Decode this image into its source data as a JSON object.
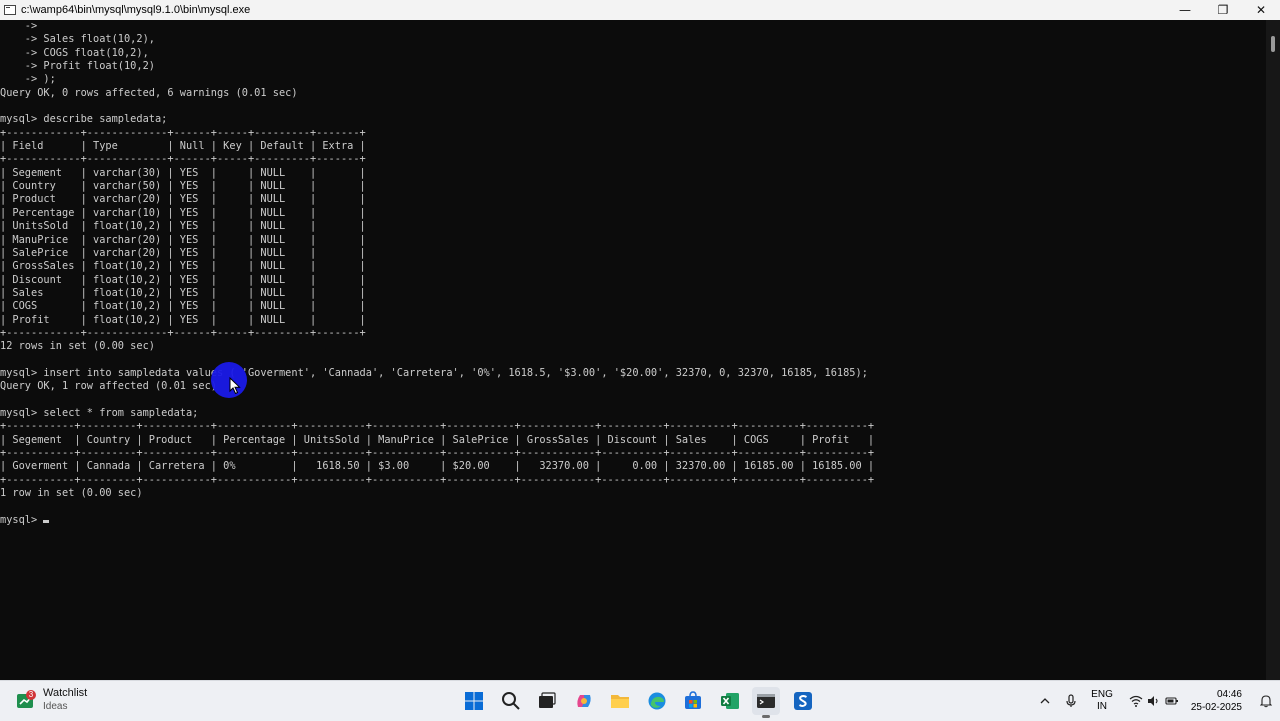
{
  "window": {
    "title": "c:\\wamp64\\bin\\mysql\\mysql9.1.0\\bin\\mysql.exe",
    "minimize_glyph": "—",
    "maximize_glyph": "❐",
    "close_glyph": "✕"
  },
  "terminal_lines": [
    "    ->",
    "    -> Sales float(10,2),",
    "    -> COGS float(10,2),",
    "    -> Profit float(10,2)",
    "    -> );",
    "Query OK, 0 rows affected, 6 warnings (0.01 sec)",
    "",
    "mysql> describe sampledata;",
    "+------------+-------------+------+-----+---------+-------+",
    "| Field      | Type        | Null | Key | Default | Extra |",
    "+------------+-------------+------+-----+---------+-------+",
    "| Segement   | varchar(30) | YES  |     | NULL    |       |",
    "| Country    | varchar(50) | YES  |     | NULL    |       |",
    "| Product    | varchar(20) | YES  |     | NULL    |       |",
    "| Percentage | varchar(10) | YES  |     | NULL    |       |",
    "| UnitsSold  | float(10,2) | YES  |     | NULL    |       |",
    "| ManuPrice  | varchar(20) | YES  |     | NULL    |       |",
    "| SalePrice  | varchar(20) | YES  |     | NULL    |       |",
    "| GrossSales | float(10,2) | YES  |     | NULL    |       |",
    "| Discount   | float(10,2) | YES  |     | NULL    |       |",
    "| Sales      | float(10,2) | YES  |     | NULL    |       |",
    "| COGS       | float(10,2) | YES  |     | NULL    |       |",
    "| Profit     | float(10,2) | YES  |     | NULL    |       |",
    "+------------+-------------+------+-----+---------+-------+",
    "12 rows in set (0.00 sec)",
    "",
    "mysql> insert into sampledata values ( 'Goverment', 'Cannada', 'Carretera', '0%', 1618.5, '$3.00', '$20.00', 32370, 0, 32370, 16185, 16185);",
    "Query OK, 1 row affected (0.01 sec)",
    "",
    "mysql> select * from sampledata;",
    "+-----------+---------+-----------+------------+-----------+-----------+-----------+------------+----------+----------+----------+----------+",
    "| Segement  | Country | Product   | Percentage | UnitsSold | ManuPrice | SalePrice | GrossSales | Discount | Sales    | COGS     | Profit   |",
    "+-----------+---------+-----------+------------+-----------+-----------+-----------+------------+----------+----------+----------+----------+",
    "| Goverment | Cannada | Carretera | 0%         |   1618.50 | $3.00     | $20.00    |   32370.00 |     0.00 | 32370.00 | 16185.00 | 16185.00 |",
    "+-----------+---------+-----------+------------+-----------+-----------+-----------+------------+----------+----------+----------+----------+",
    "1 row in set (0.00 sec)",
    ""
  ],
  "prompt": "mysql> ",
  "taskbar": {
    "widget_badge": "3",
    "widget_title": "Watchlist",
    "widget_sub": "Ideas",
    "language_line1": "ENG",
    "language_line2": "IN",
    "time": "04:46",
    "date": "25-02-2025"
  },
  "colors": {
    "terminal_bg": "#0c0c0c",
    "terminal_text": "#cccccc",
    "click_highlight": "#1a1ae8",
    "taskbar_bg": "#eef0f4"
  },
  "icons": [
    "start-icon",
    "search-icon",
    "task-view-icon",
    "copilot-icon",
    "file-explorer-icon",
    "edge-icon",
    "store-icon",
    "excel-icon",
    "terminal-icon",
    "app-s-icon"
  ]
}
